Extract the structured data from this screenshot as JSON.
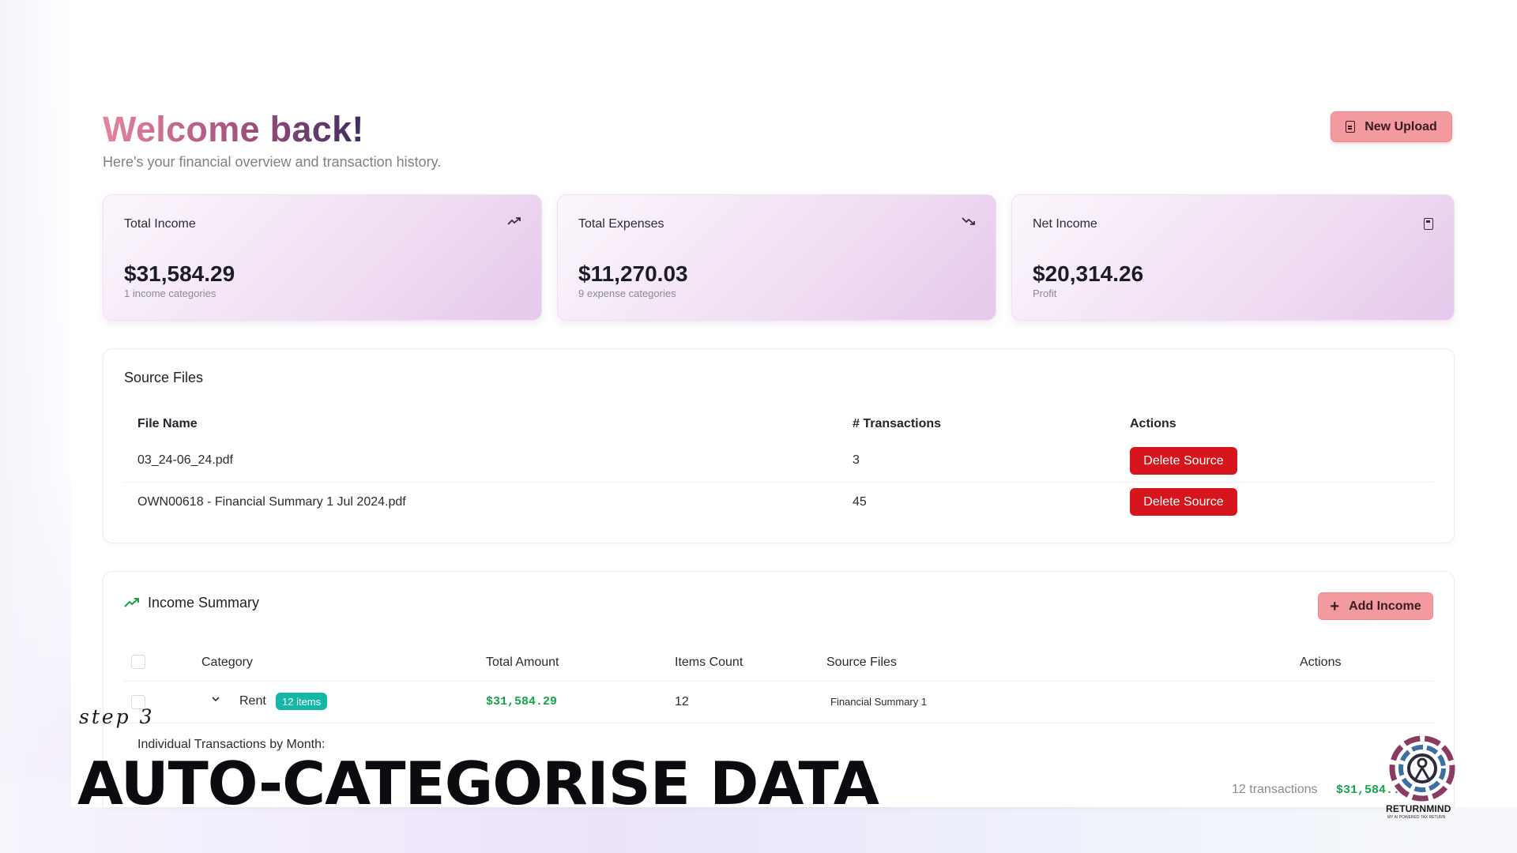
{
  "header": {
    "title": "Welcome back!",
    "subtitle": "Here's your financial overview and transaction history.",
    "new_upload_label": "New Upload"
  },
  "summary_cards": [
    {
      "label": "Total Income",
      "value": "$31,584.29",
      "sub": "1 income categories",
      "icon": "trend-up-icon"
    },
    {
      "label": "Total Expenses",
      "value": "$11,270.03",
      "sub": "9 expense categories",
      "icon": "trend-down-icon"
    },
    {
      "label": "Net Income",
      "value": "$20,314.26",
      "sub": "Profit",
      "icon": "calculator-icon"
    }
  ],
  "source_files": {
    "title": "Source Files",
    "columns": [
      "File Name",
      "# Transactions",
      "Actions"
    ],
    "rows": [
      {
        "file": "03_24-06_24.pdf",
        "transactions": "3",
        "action": "Delete Source"
      },
      {
        "file": "OWN00618 - Financial Summary 1 Jul 2024.pdf",
        "transactions": "45",
        "action": "Delete Source"
      }
    ]
  },
  "income_summary": {
    "title": "Income Summary",
    "add_label": "Add Income",
    "columns": [
      "Category",
      "Total Amount",
      "Items Count",
      "Source Files",
      "Actions"
    ],
    "row": {
      "category": "Rent",
      "badge": "12 items",
      "total": "$31,584.29",
      "count": "12",
      "source": "Financial Summary 1"
    },
    "detail_heading": "Individual Transactions by Month:",
    "detail_count": "12 transactions",
    "detail_total": "$31,584.."
  },
  "overlay": {
    "step": "step 3",
    "headline": "AUTO-CATEGORISE DATA"
  },
  "brand": {
    "name": "RETURNMIND",
    "tagline": "MY AI POWERED TAX RETURN"
  },
  "colors": {
    "accent": "#f29a9d",
    "danger": "#d6161c",
    "positive": "#16a34a",
    "badge": "#14b8a6"
  }
}
